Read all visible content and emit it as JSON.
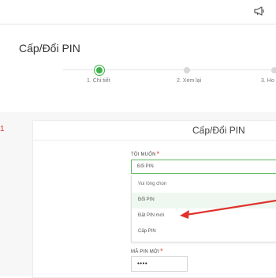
{
  "header": {
    "notification_icon": "megaphone-icon"
  },
  "page": {
    "title": "Cấp/Đổi PIN"
  },
  "steps": [
    {
      "label": "1. Chi tiết",
      "state": "active"
    },
    {
      "label": "2. Xem lại",
      "state": "inactive"
    },
    {
      "label": "3. Ho",
      "state": "inactive"
    }
  ],
  "side_marker": "1",
  "card": {
    "title": "Cấp/Đổi PIN"
  },
  "form": {
    "want_label": "TÔI MUỐN",
    "required_mark": "*",
    "want_value": "Đổi PIN",
    "options": [
      "Vui lòng chọn",
      "Đổi PIN",
      "Đặt PIN mới",
      "Cấp PIN"
    ],
    "new_pin_label": "MÃ PIN MỚI",
    "new_pin_value": "••••"
  },
  "colors": {
    "accent": "#3cb44b",
    "required": "#e0322d",
    "annotation_arrow": "#e0322d"
  }
}
